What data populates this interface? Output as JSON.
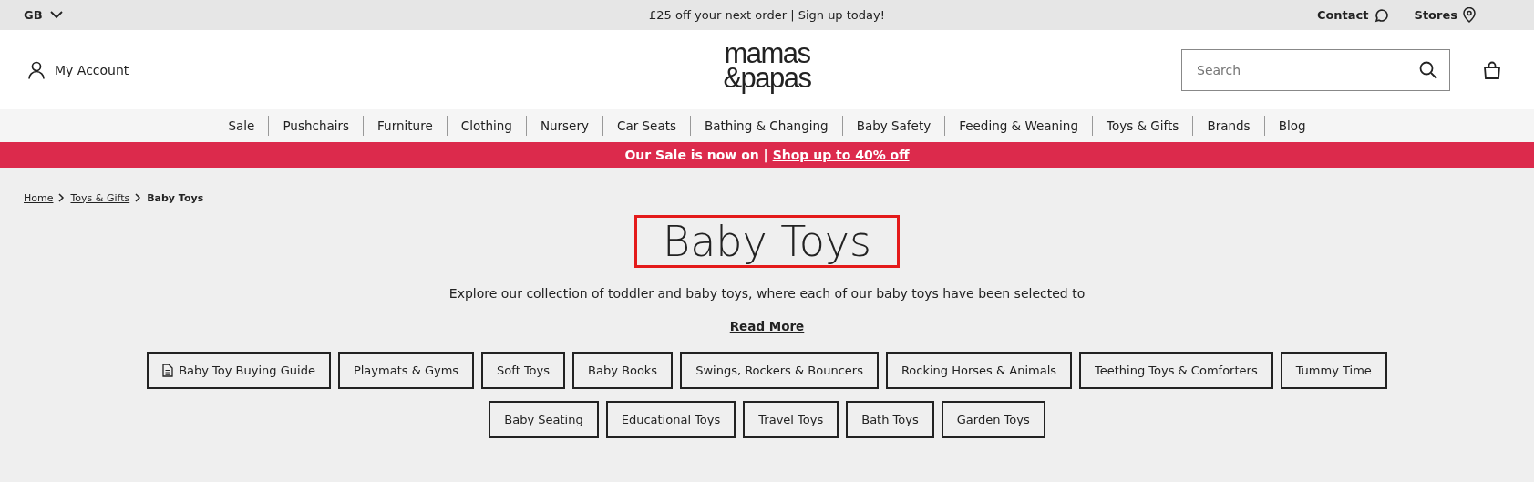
{
  "top_bar": {
    "region": "GB",
    "promo": "£25 off your next order | Sign up today!",
    "links": [
      {
        "label": "Contact",
        "kind": "chat"
      },
      {
        "label": "Stores",
        "kind": "pin"
      }
    ]
  },
  "header": {
    "account": "My Account",
    "logo": [
      "mamas",
      "&papas"
    ],
    "search": {
      "placeholder": "Search"
    }
  },
  "nav": [
    "Sale",
    "Pushchairs",
    "Furniture",
    "Clothing",
    "Nursery",
    "Car Seats",
    "Bathing & Changing",
    "Baby Safety",
    "Feeding & Weaning",
    "Toys & Gifts",
    "Brands",
    "Blog"
  ],
  "banner": {
    "text": "Our Sale is now on | ",
    "link": "Shop up to 40% off"
  },
  "breadcrumb": [
    {
      "label": "Home",
      "current": false
    },
    {
      "label": "Toys & Gifts",
      "current": false
    },
    {
      "label": "Baby Toys",
      "current": true
    }
  ],
  "title": "Baby Toys",
  "description": "Explore our collection of toddler and baby toys, where each of our baby toys have been selected to",
  "read_more": "Read More",
  "categories": [
    {
      "label": "Baby Toy Buying Guide",
      "kind": "guide"
    },
    {
      "label": "Playmats & Gyms",
      "kind": "link"
    },
    {
      "label": "Soft Toys",
      "kind": "link"
    },
    {
      "label": "Baby Books",
      "kind": "link"
    },
    {
      "label": "Swings, Rockers & Bouncers",
      "kind": "link"
    },
    {
      "label": "Rocking Horses & Animals",
      "kind": "link"
    },
    {
      "label": "Teething Toys & Comforters",
      "kind": "link"
    },
    {
      "label": "Tummy Time",
      "kind": "link"
    },
    {
      "label": "Baby Seating",
      "kind": "link"
    },
    {
      "label": "Educational Toys",
      "kind": "link"
    },
    {
      "label": "Travel Toys",
      "kind": "link"
    },
    {
      "label": "Bath Toys",
      "kind": "link"
    },
    {
      "label": "Garden Toys",
      "kind": "link"
    }
  ]
}
